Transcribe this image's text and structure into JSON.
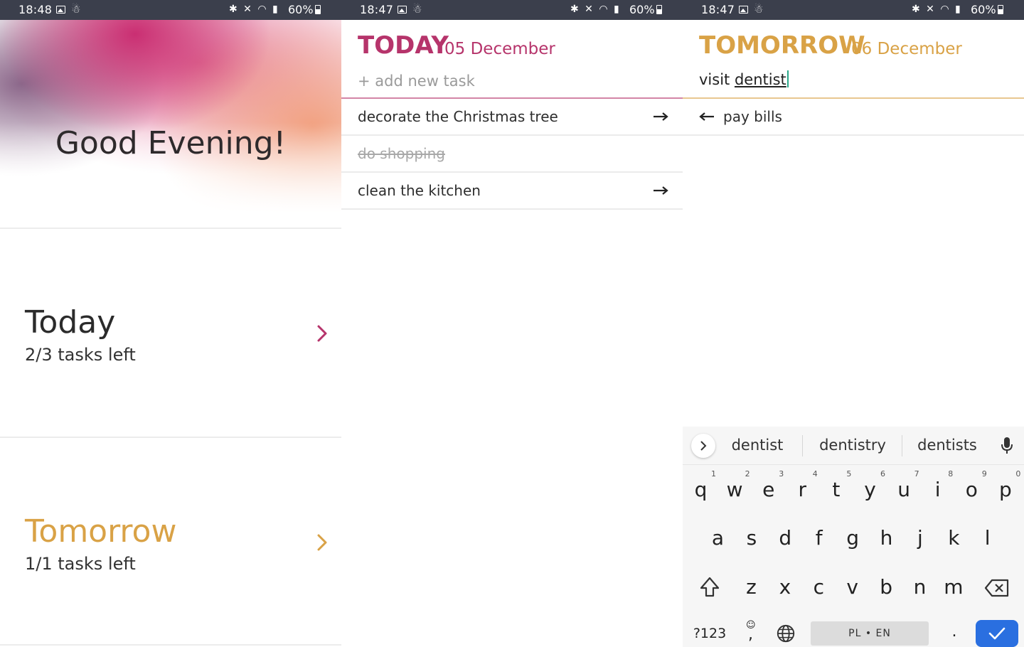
{
  "colors": {
    "today": "#b6346b",
    "tomorrow": "#d9a246",
    "statusbar": "#3b3f4c",
    "keyboard_enter": "#2a6fe0"
  },
  "panels": [
    {
      "status": {
        "time": "18:48",
        "battery": "60%"
      }
    },
    {
      "status": {
        "time": "18:47",
        "battery": "60%"
      }
    },
    {
      "status": {
        "time": "18:47",
        "battery": "60%"
      }
    }
  ],
  "home": {
    "greeting": "Good Evening!",
    "today": {
      "title": "Today",
      "count": "2/3 tasks left"
    },
    "tomorrow": {
      "title": "Tomorrow",
      "count": "1/1 tasks left"
    }
  },
  "today_list": {
    "title": "TODAY",
    "date": "05 December",
    "add_placeholder": "+ add new task",
    "tasks": [
      {
        "label": "decorate the Christmas tree",
        "done": false
      },
      {
        "label": "do shopping",
        "done": true
      },
      {
        "label": "clean the kitchen",
        "done": false
      }
    ]
  },
  "tomorrow_list": {
    "title": "TOMORROW",
    "date": "06 December",
    "input_prefix": "visit ",
    "input_word": "dentist",
    "tasks": [
      {
        "label": "pay bills",
        "done": false
      }
    ]
  },
  "keyboard": {
    "suggestions": [
      "dentist",
      "dentistry",
      "dentists"
    ],
    "row1": [
      "q",
      "w",
      "e",
      "r",
      "t",
      "y",
      "u",
      "i",
      "o",
      "p"
    ],
    "row1_hints": [
      "1",
      "2",
      "3",
      "4",
      "5",
      "6",
      "7",
      "8",
      "9",
      "0"
    ],
    "row2": [
      "a",
      "s",
      "d",
      "f",
      "g",
      "h",
      "j",
      "k",
      "l"
    ],
    "row3": [
      "z",
      "x",
      "c",
      "v",
      "b",
      "n",
      "m"
    ],
    "symbols_label": "?123",
    "comma_label": ",",
    "space_label": "PL • EN",
    "period_label": "."
  }
}
